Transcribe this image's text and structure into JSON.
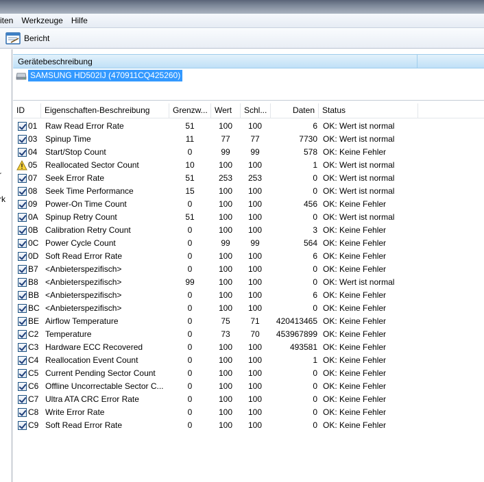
{
  "menu": [
    "riten",
    "Werkzeuge",
    "Hilfe"
  ],
  "toolbar": {
    "report_label": "Bericht"
  },
  "left_fragments": [
    "r",
    "rk"
  ],
  "device": {
    "header": "Gerätebeschreibung",
    "name": "SAMSUNG HD502IJ (470911CQ425260)"
  },
  "columns": [
    "ID",
    "Eigenschaften-Beschreibung",
    "Grenzw...",
    "Wert",
    "Schl...",
    "Daten",
    "Status"
  ],
  "rows": [
    {
      "id": "01",
      "desc": "Raw Read Error Rate",
      "thr": "51",
      "val": "100",
      "wor": "100",
      "dat": "6",
      "status": "OK: Wert ist normal",
      "icon": "check"
    },
    {
      "id": "03",
      "desc": "Spinup Time",
      "thr": "11",
      "val": "77",
      "wor": "77",
      "dat": "7730",
      "status": "OK: Wert ist normal",
      "icon": "check"
    },
    {
      "id": "04",
      "desc": "Start/Stop Count",
      "thr": "0",
      "val": "99",
      "wor": "99",
      "dat": "578",
      "status": "OK: Keine Fehler",
      "icon": "check"
    },
    {
      "id": "05",
      "desc": "Reallocated Sector Count",
      "thr": "10",
      "val": "100",
      "wor": "100",
      "dat": "1",
      "status": "OK: Wert ist normal",
      "icon": "warning"
    },
    {
      "id": "07",
      "desc": "Seek Error Rate",
      "thr": "51",
      "val": "253",
      "wor": "253",
      "dat": "0",
      "status": "OK: Wert ist normal",
      "icon": "check"
    },
    {
      "id": "08",
      "desc": "Seek Time Performance",
      "thr": "15",
      "val": "100",
      "wor": "100",
      "dat": "0",
      "status": "OK: Wert ist normal",
      "icon": "check"
    },
    {
      "id": "09",
      "desc": "Power-On Time Count",
      "thr": "0",
      "val": "100",
      "wor": "100",
      "dat": "456",
      "status": "OK: Keine Fehler",
      "icon": "check"
    },
    {
      "id": "0A",
      "desc": "Spinup Retry Count",
      "thr": "51",
      "val": "100",
      "wor": "100",
      "dat": "0",
      "status": "OK: Wert ist normal",
      "icon": "check"
    },
    {
      "id": "0B",
      "desc": "Calibration Retry Count",
      "thr": "0",
      "val": "100",
      "wor": "100",
      "dat": "3",
      "status": "OK: Keine Fehler",
      "icon": "check"
    },
    {
      "id": "0C",
      "desc": "Power Cycle Count",
      "thr": "0",
      "val": "99",
      "wor": "99",
      "dat": "564",
      "status": "OK: Keine Fehler",
      "icon": "check"
    },
    {
      "id": "0D",
      "desc": "Soft Read Error Rate",
      "thr": "0",
      "val": "100",
      "wor": "100",
      "dat": "6",
      "status": "OK: Keine Fehler",
      "icon": "check"
    },
    {
      "id": "B7",
      "desc": "<Anbieterspezifisch>",
      "thr": "0",
      "val": "100",
      "wor": "100",
      "dat": "0",
      "status": "OK: Keine Fehler",
      "icon": "check"
    },
    {
      "id": "B8",
      "desc": "<Anbieterspezifisch>",
      "thr": "99",
      "val": "100",
      "wor": "100",
      "dat": "0",
      "status": "OK: Wert ist normal",
      "icon": "check"
    },
    {
      "id": "BB",
      "desc": "<Anbieterspezifisch>",
      "thr": "0",
      "val": "100",
      "wor": "100",
      "dat": "6",
      "status": "OK: Keine Fehler",
      "icon": "check"
    },
    {
      "id": "BC",
      "desc": "<Anbieterspezifisch>",
      "thr": "0",
      "val": "100",
      "wor": "100",
      "dat": "0",
      "status": "OK: Keine Fehler",
      "icon": "check"
    },
    {
      "id": "BE",
      "desc": "Airflow Temperature",
      "thr": "0",
      "val": "75",
      "wor": "71",
      "dat": "420413465",
      "status": "OK: Keine Fehler",
      "icon": "check"
    },
    {
      "id": "C2",
      "desc": "Temperature",
      "thr": "0",
      "val": "73",
      "wor": "70",
      "dat": "453967899",
      "status": "OK: Keine Fehler",
      "icon": "check"
    },
    {
      "id": "C3",
      "desc": "Hardware ECC Recovered",
      "thr": "0",
      "val": "100",
      "wor": "100",
      "dat": "493581",
      "status": "OK: Keine Fehler",
      "icon": "check"
    },
    {
      "id": "C4",
      "desc": "Reallocation Event Count",
      "thr": "0",
      "val": "100",
      "wor": "100",
      "dat": "1",
      "status": "OK: Keine Fehler",
      "icon": "check"
    },
    {
      "id": "C5",
      "desc": "Current Pending Sector Count",
      "thr": "0",
      "val": "100",
      "wor": "100",
      "dat": "0",
      "status": "OK: Keine Fehler",
      "icon": "check"
    },
    {
      "id": "C6",
      "desc": "Offline Uncorrectable Sector C...",
      "thr": "0",
      "val": "100",
      "wor": "100",
      "dat": "0",
      "status": "OK: Keine Fehler",
      "icon": "check"
    },
    {
      "id": "C7",
      "desc": "Ultra ATA CRC Error Rate",
      "thr": "0",
      "val": "100",
      "wor": "100",
      "dat": "0",
      "status": "OK: Keine Fehler",
      "icon": "check"
    },
    {
      "id": "C8",
      "desc": "Write Error Rate",
      "thr": "0",
      "val": "100",
      "wor": "100",
      "dat": "0",
      "status": "OK: Keine Fehler",
      "icon": "check"
    },
    {
      "id": "C9",
      "desc": "Soft Read Error Rate",
      "thr": "0",
      "val": "100",
      "wor": "100",
      "dat": "0",
      "status": "OK: Keine Fehler",
      "icon": "check"
    }
  ]
}
